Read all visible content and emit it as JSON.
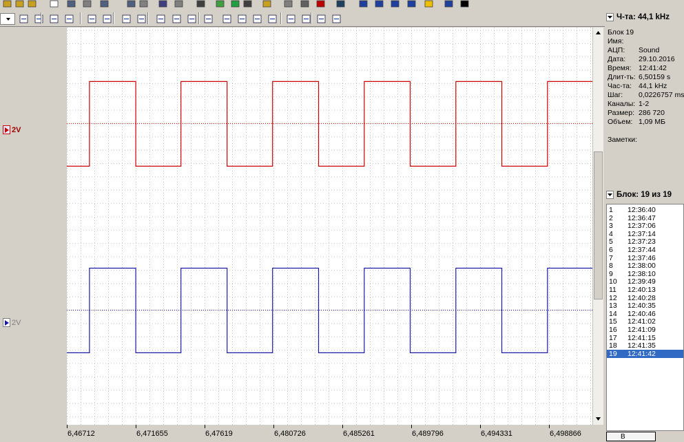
{
  "header": {
    "rate_label": "Ч-та: 44,1 kHz"
  },
  "info": {
    "block_title": "Блок 19",
    "fields": [
      {
        "key": "Имя:",
        "value": ""
      },
      {
        "key": "АЦП:",
        "value": "Sound"
      },
      {
        "key": "Дата:",
        "value": "29.10.2016"
      },
      {
        "key": "Время:",
        "value": "12:41:42"
      },
      {
        "key": "Длит-ть:",
        "value": "6,50159 s"
      },
      {
        "key": "Час-та:",
        "value": "44,1 kHz"
      },
      {
        "key": "Шаг:",
        "value": "0,0226757 ms"
      },
      {
        "key": "Каналы:",
        "value": "1-2"
      },
      {
        "key": "Размер:",
        "value": "286 720"
      },
      {
        "key": "Объем:",
        "value": "1,09 МБ"
      }
    ],
    "notes_label": "Заметки:"
  },
  "block_list": {
    "header": "Блок: 19 из 19",
    "selected": 19,
    "items": [
      {
        "n": "1",
        "t": "12:36:40"
      },
      {
        "n": "2",
        "t": "12:36:47"
      },
      {
        "n": "3",
        "t": "12:37:06"
      },
      {
        "n": "4",
        "t": "12:37:14"
      },
      {
        "n": "5",
        "t": "12:37:23"
      },
      {
        "n": "6",
        "t": "12:37:44"
      },
      {
        "n": "7",
        "t": "12:37:46"
      },
      {
        "n": "8",
        "t": "12:38:00"
      },
      {
        "n": "9",
        "t": "12:38:10"
      },
      {
        "n": "10",
        "t": "12:39:49"
      },
      {
        "n": "11",
        "t": "12:40:13"
      },
      {
        "n": "12",
        "t": "12:40:28"
      },
      {
        "n": "13",
        "t": "12:40:35"
      },
      {
        "n": "14",
        "t": "12:40:46"
      },
      {
        "n": "15",
        "t": "12:41:02"
      },
      {
        "n": "16",
        "t": "12:41:09"
      },
      {
        "n": "17",
        "t": "12:41:15"
      },
      {
        "n": "18",
        "t": "12:41:35"
      },
      {
        "n": "19",
        "t": "12:41:42"
      }
    ]
  },
  "channels": [
    {
      "scale_label": "2V",
      "color": "#cc0000",
      "offset": 0,
      "high": 3.15,
      "low": -3.2
    },
    {
      "scale_label": "2V",
      "color": "#1a1aa8",
      "offset": -14,
      "high": -10.85,
      "low": -17.2
    }
  ],
  "chart_data": {
    "type": "line",
    "y_ticks": [
      6,
      4,
      2,
      0,
      -2,
      -4,
      -6,
      -8,
      -10,
      -12,
      -14,
      -16,
      -18,
      -20
    ],
    "ylim": [
      -22.6,
      7.2
    ],
    "x_ticks": [
      "6,46712",
      "6,471655",
      "6,47619",
      "6,480726",
      "6,485261",
      "6,489796",
      "6,494331",
      "6,498866"
    ],
    "xlim": [
      6.46712,
      6.5028
    ],
    "square_wave": {
      "period_s": 0.006222,
      "rise_times_s": [
        6.46866,
        6.47487,
        6.48109,
        6.48731,
        6.49353,
        6.49975
      ],
      "fall_times_s": [
        6.4718,
        6.478,
        6.48421,
        6.49043,
        6.49665
      ]
    },
    "series": [
      {
        "color": "#cc0000",
        "baseline": 0,
        "high": 3.15,
        "low": -3.2
      },
      {
        "color": "#1a1aa8",
        "baseline": -14,
        "high": -10.85,
        "low": -17.2
      }
    ]
  },
  "menu_partial": {
    "bottom_button": "В"
  }
}
